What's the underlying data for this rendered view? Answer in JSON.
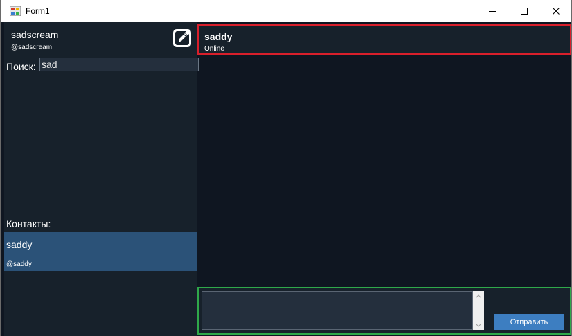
{
  "window": {
    "title": "Form1"
  },
  "sidebar": {
    "user_name": "sadscream",
    "user_handle": "@sadscream",
    "search_label": "Поиск:",
    "search_value": "sad",
    "contacts_label": "Контакты:",
    "contacts": [
      {
        "name": "saddy",
        "handle": "@saddy",
        "selected": true
      }
    ]
  },
  "chat": {
    "title": "saddy",
    "status": "Online"
  },
  "compose": {
    "send_label": "Отправить",
    "message_value": ""
  },
  "icons": {
    "app": "winforms-app-icon",
    "edit": "edit-pencil-icon",
    "minimize": "minimize-icon",
    "maximize": "maximize-icon",
    "close": "close-icon"
  },
  "colors": {
    "background": "#0f1621",
    "panel": "#17212b",
    "selected_contact": "#2b5278",
    "send_button": "#3d7ec1",
    "header_highlight": "#d91f2b",
    "compose_highlight": "#2fa84a"
  }
}
